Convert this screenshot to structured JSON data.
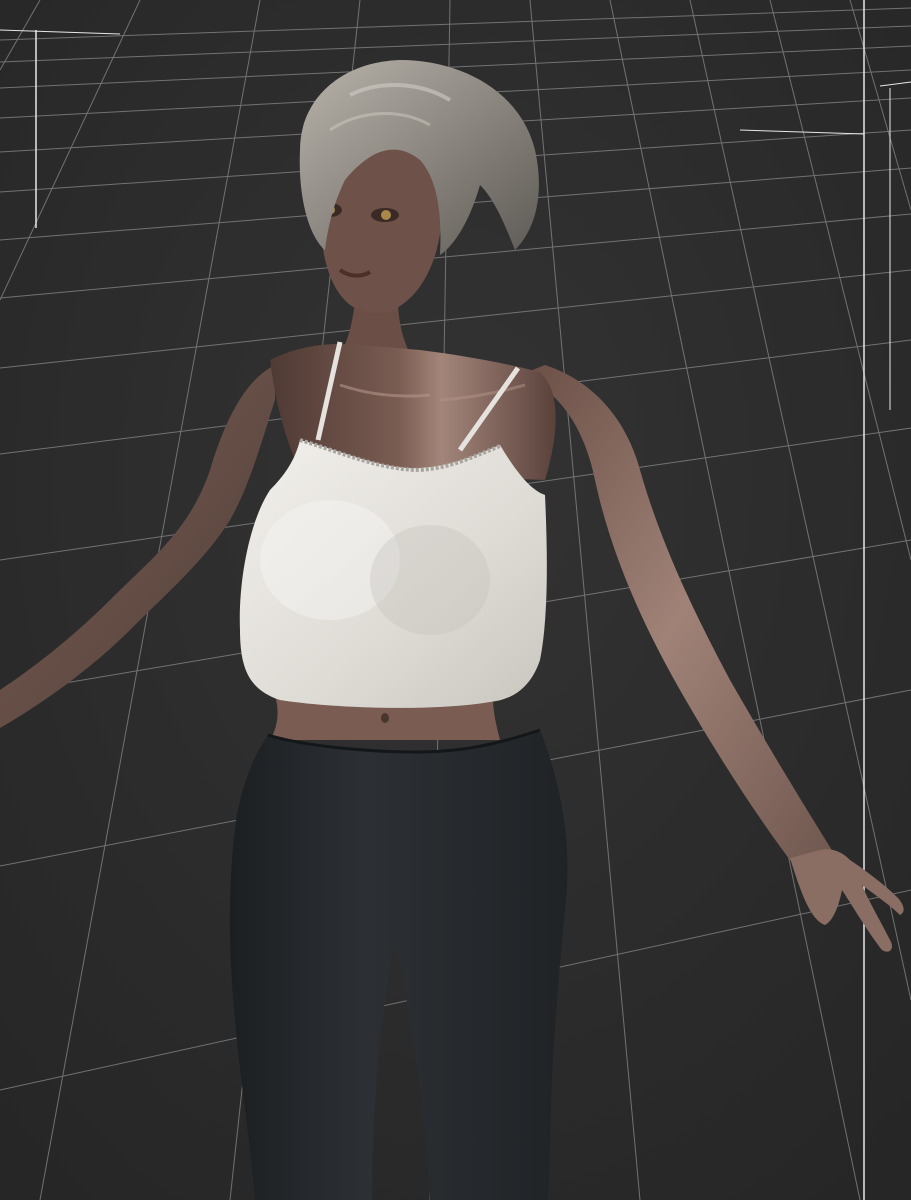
{
  "viewport": {
    "background": "#2b2b2b",
    "grid_color": "#8a8a8a",
    "bounding_box_color": "#e8e8e8"
  },
  "scene": {
    "figure": {
      "skin_color": "#6e5148",
      "skin_highlight": "#a88a80",
      "hair_color": "#9a958e",
      "top_color": "#e9e7e2",
      "pants_color": "#26292d"
    }
  }
}
